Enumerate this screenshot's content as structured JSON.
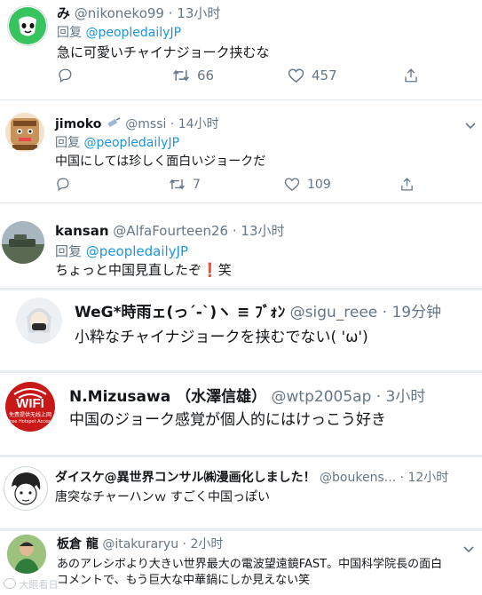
{
  "reply_prefix": "回复",
  "tweets": [
    {
      "display_name": "み",
      "handle": "@nikoneko99",
      "time": "13小时",
      "reply_to": "@peopledailyJP",
      "text": "急に可愛いチャイナジョーク挟むな",
      "retweets": "66",
      "likes": "457"
    },
    {
      "display_name": "jimoko",
      "handle": "@mssi",
      "time": "14小时",
      "reply_to": "@peopledailyJP",
      "text": "中国にしては珍しく面白いジョークだ",
      "retweets": "7",
      "likes": "109"
    },
    {
      "display_name": "kansan",
      "handle": "@AlfaFourteen26",
      "time": "13小时",
      "reply_to": "@peopledailyJP",
      "text": "ちょっと中国見直したぞ",
      "text_suffix": "❗",
      "text_end": "笑"
    },
    {
      "display_name": "WeG*時雨ェ(っ´-`)ヽ ≡ ﾌﾞｫﾝ",
      "handle": "@sigu_reee",
      "time": "19分钟",
      "text": "小粋なチャイナジョークを挟むでない( 'ω')"
    },
    {
      "display_name": "N.Mizusawa （水澤信雄）",
      "handle": "@wtp2005ap",
      "time": "3小时",
      "text": "中国のジョーク感覚が個人的にはけっこう好き",
      "avatar_text": "WIFI",
      "avatar_subtext": "免费提供无线上网",
      "avatar_subtext2": "Free Hotspot Access"
    },
    {
      "display_name": "ダイスケ@異世界コンサル㈱漫画化しました！",
      "handle": "@boukens...",
      "time": "12小时",
      "text": "唐突なチャーハンｗ すごく中国っぽい"
    },
    {
      "display_name": "板倉 龍",
      "handle": "@itakuraryu",
      "time": "2小时",
      "text_line1": "あのアレシボより大きい世界最大の電波望遠鏡FAST。中国科学院長の面白",
      "text_line2": "コメントで、もう巨大な中華鍋にしか見えない笑"
    }
  ],
  "watermark": "大眼看日",
  "colors": {
    "link": "#1b95e0",
    "muted": "#657786",
    "separator": "#e1e8ed"
  }
}
